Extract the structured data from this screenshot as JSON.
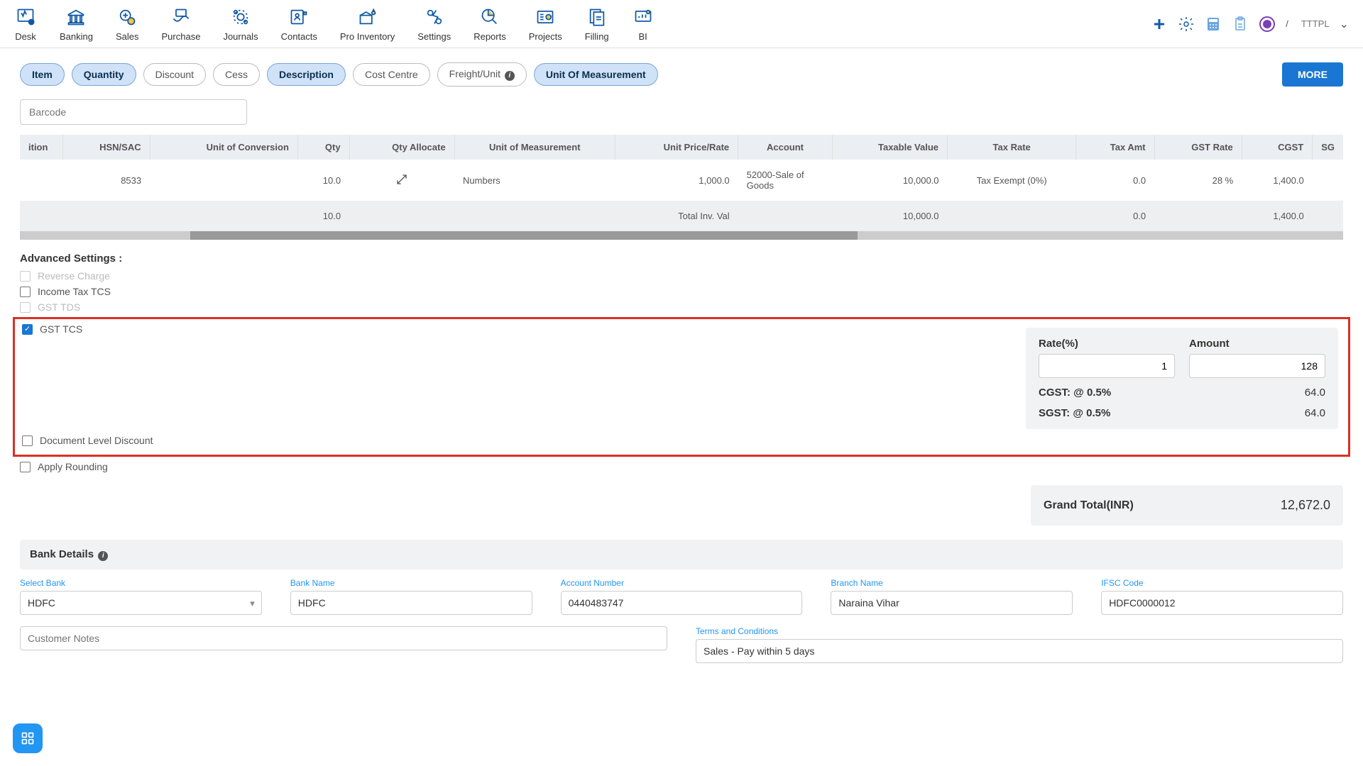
{
  "nav": {
    "items": [
      "Desk",
      "Banking",
      "Sales",
      "Purchase",
      "Journals",
      "Contacts",
      "Pro Inventory",
      "Settings",
      "Reports",
      "Projects",
      "Filling",
      "BI"
    ],
    "company": "TTTPL"
  },
  "pills": [
    "Item",
    "Quantity",
    "Discount",
    "Cess",
    "Description",
    "Cost Centre",
    "Freight/Unit",
    "Unit Of Measurement"
  ],
  "more_label": "MORE",
  "barcode_placeholder": "Barcode",
  "table": {
    "headers": [
      "ition",
      "HSN/SAC",
      "Unit of Conversion",
      "Qty",
      "Qty Allocate",
      "Unit of Measurement",
      "Unit Price/Rate",
      "Account",
      "Taxable Value",
      "Tax Rate",
      "Tax Amt",
      "GST Rate",
      "CGST",
      "SG"
    ],
    "row": {
      "hsn": "8533",
      "qty": "10.0",
      "uom": "Numbers",
      "unit_price": "1,000.0",
      "account": "52000-Sale of Goods",
      "taxable_value": "10,000.0",
      "tax_rate": "Tax Exempt (0%)",
      "tax_amt": "0.0",
      "gst_rate": "28 %",
      "cgst": "1,400.0"
    },
    "total": {
      "label": "Total Inv. Val",
      "qty": "10.0",
      "taxable_value": "10,000.0",
      "tax_amt": "0.0",
      "cgst": "1,400.0"
    }
  },
  "adv": {
    "title": "Advanced Settings :",
    "reverse_charge": "Reverse Charge",
    "income_tax_tcs": "Income Tax TCS",
    "gst_tds": "GST TDS",
    "gst_tcs": "GST TCS",
    "doc_discount": "Document Level Discount",
    "apply_rounding": "Apply Rounding"
  },
  "tcs": {
    "rate_label": "Rate(%)",
    "amount_label": "Amount",
    "rate_value": "1",
    "amount_value": "128",
    "cgst_label": "CGST: @ 0.5%",
    "cgst_value": "64.0",
    "sgst_label": "SGST: @ 0.5%",
    "sgst_value": "64.0"
  },
  "grand_total": {
    "label": "Grand Total(INR)",
    "value": "12,672.0"
  },
  "bank": {
    "header": "Bank Details",
    "select_bank_label": "Select Bank",
    "select_bank_value": "HDFC",
    "bank_name_label": "Bank Name",
    "bank_name_value": "HDFC",
    "account_number_label": "Account Number",
    "account_number_value": "0440483747",
    "branch_name_label": "Branch Name",
    "branch_name_value": "Naraina Vihar",
    "ifsc_label": "IFSC Code",
    "ifsc_value": "HDFC0000012"
  },
  "bottom": {
    "customer_notes_label": "Customer Notes",
    "terms_label": "Terms and Conditions",
    "terms_value": "Sales - Pay within 5 days"
  }
}
